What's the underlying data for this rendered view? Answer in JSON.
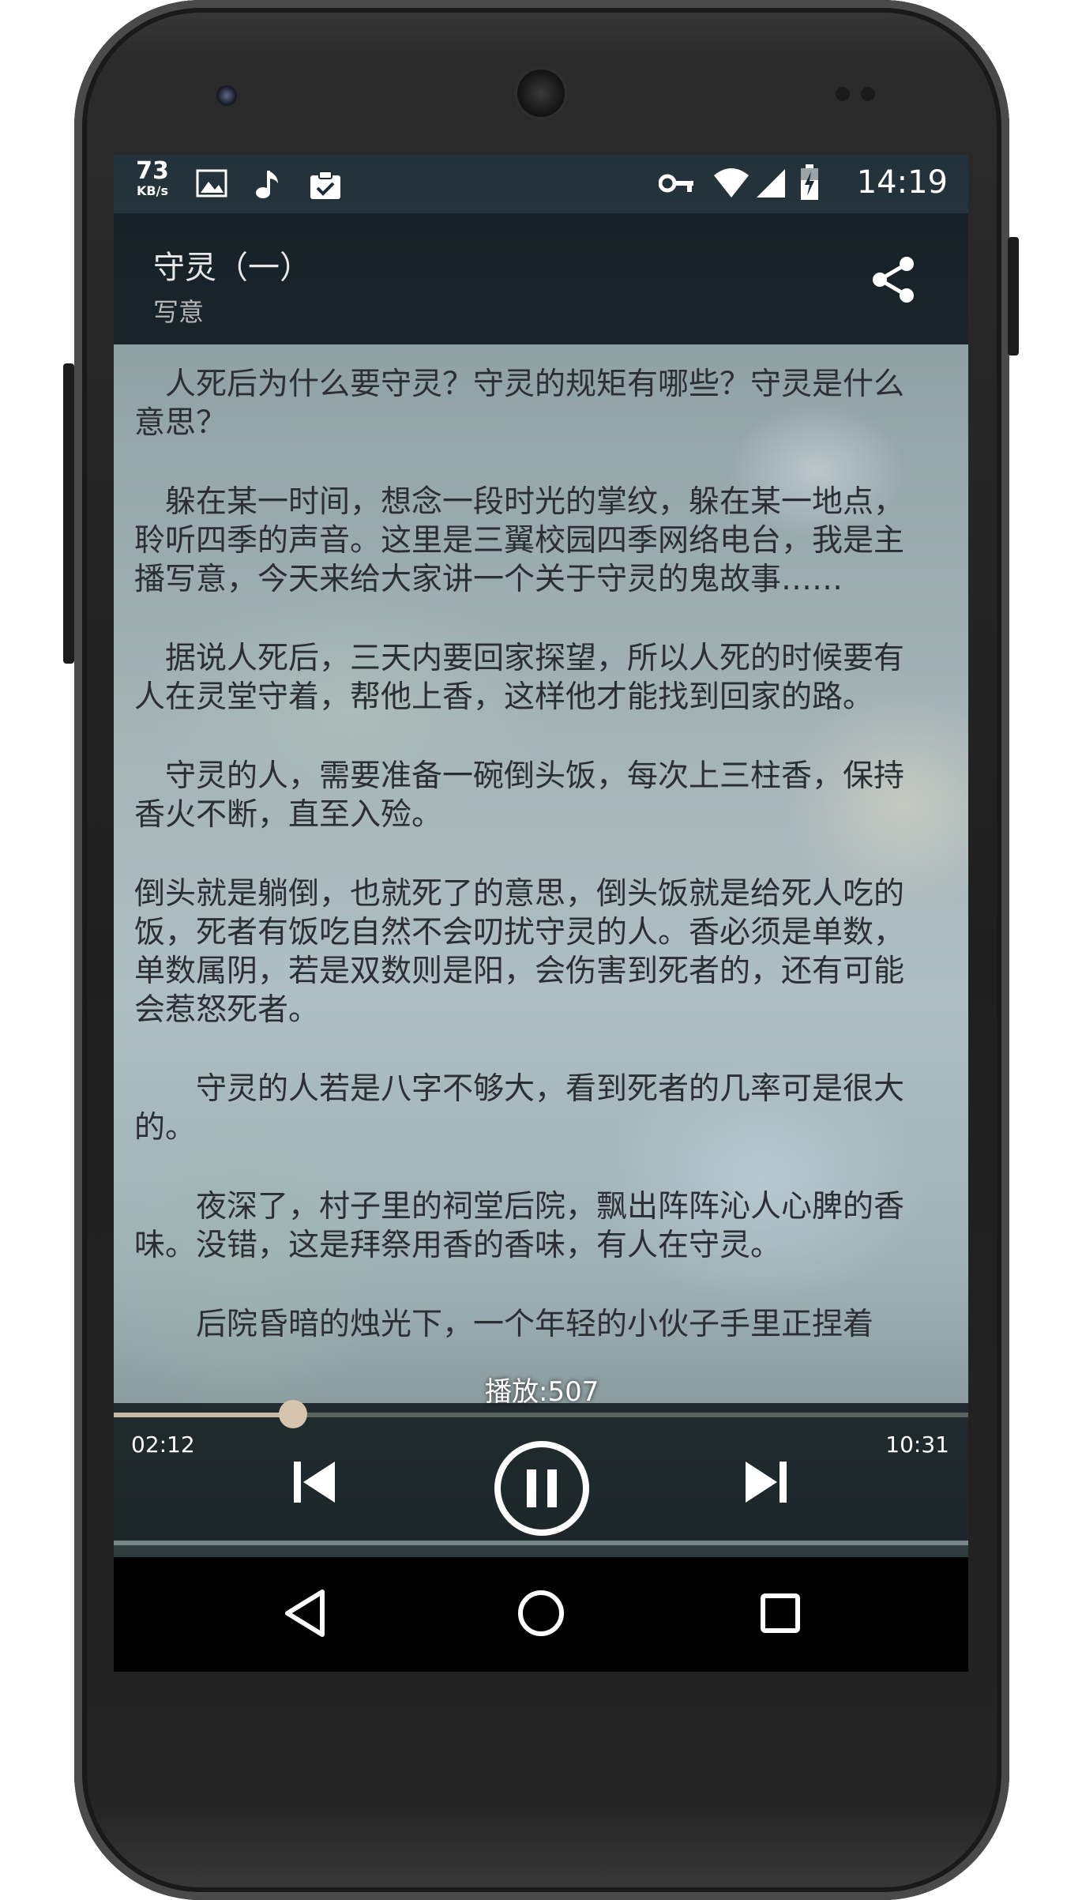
{
  "status_bar": {
    "net_speed_value": "73",
    "net_speed_unit": "KB/s",
    "time": "14:19",
    "left_icons": [
      "image-icon",
      "music-note-icon",
      "clipboard-check-icon"
    ],
    "right_icons": [
      "vpn-key-icon",
      "wifi-icon",
      "signal-icon",
      "battery-charging-icon"
    ]
  },
  "app_bar": {
    "title": "守灵（一）",
    "subtitle": "写意",
    "share_icon": "share-icon"
  },
  "content": {
    "paragraphs": [
      "　人死后为什么要守灵？守灵的规矩有哪些？守灵是什么意思？",
      "　躲在某一时间，想念一段时光的掌纹，躲在某一地点，聆听四季的声音。这里是三翼校园四季网络电台，我是主播写意，今天来给大家讲一个关于守灵的鬼故事……",
      "　据说人死后，三天内要回家探望，所以人死的时候要有人在灵堂守着，帮他上香，这样他才能找到回家的路。",
      "　守灵的人，需要准备一碗倒头饭，每次上三柱香，保持香火不断，直至入殓。",
      "倒头就是躺倒，也就死了的意思，倒头饭就是给死人吃的饭，死者有饭吃自然不会叨扰守灵的人。香必须是单数，单数属阴，若是双数则是阳，会伤害到死者的，还有可能会惹怒死者。",
      "　　守灵的人若是八字不够大，看到死者的几率可是很大的。",
      "　　夜深了，村子里的祠堂后院，飘出阵阵沁人心脾的香味。没错，这是拜祭用香的香味，有人在守灵。",
      "　　后院昏暗的烛光下，一个年轻的小伙子手里正捏着"
    ]
  },
  "player": {
    "play_count": "播放:507",
    "current_time": "02:12",
    "total_time": "10:31",
    "progress": 0.21,
    "accent_color": "#c8b8a2",
    "controls": [
      "skip-previous-icon",
      "pause-icon",
      "skip-next-icon"
    ]
  },
  "nav_bar": {
    "buttons": [
      "back-icon",
      "home-icon",
      "recents-icon"
    ]
  }
}
